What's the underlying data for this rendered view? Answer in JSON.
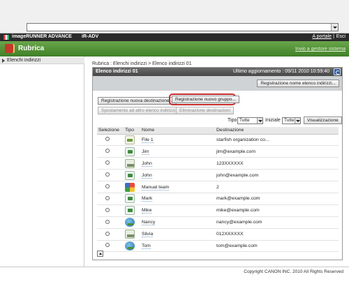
{
  "topbar": {
    "brand": "imageRUNNER ADVANCE",
    "model": "iR-ADV",
    "portal": "A portale",
    "separator": "|",
    "exit": "Esci"
  },
  "header": {
    "title": "Rubrica",
    "goto": "Invio a gestore sistema"
  },
  "sidebar": {
    "items": [
      {
        "label": "Elenchi indirizzi"
      }
    ]
  },
  "breadcrumb": "Rubrica : Elenchi indirizzi > Elenco indirizzi 01",
  "panel": {
    "title": "Elenco indirizzi 01",
    "updated": "Ultimo aggiornamento : 09/11 2010 10:59:40",
    "register_name_button": "Registrazione nome elenco indirizzi...",
    "register_dest_button": "Registrazione nuova destinazione...",
    "register_group_button": "Registrazione nuovo gruppo...",
    "move_button": "Spostamento ad altro elenco indirizzi...",
    "delete_button": "Eliminazione destinazioni"
  },
  "filters": {
    "type_label": "Tipo",
    "type_value": "Tutte",
    "initial_label": "Iniziale",
    "initial_value": "Tutte",
    "show_button": "Visualizzazione"
  },
  "table": {
    "headers": [
      "Selezione",
      "Tipo",
      "Nome",
      "Destinazione"
    ],
    "rows": [
      {
        "type_icon": "file-icon",
        "name": "File 1",
        "destination": "starfish organization co..."
      },
      {
        "type_icon": "email-icon",
        "name": "Jim",
        "destination": "jim@example.com"
      },
      {
        "type_icon": "fax-icon",
        "name": "John",
        "destination": "123XXXXXX"
      },
      {
        "type_icon": "email-icon",
        "name": "John",
        "destination": "john@example.com"
      },
      {
        "type_icon": "group-icon",
        "name": "Manual team",
        "destination": "2"
      },
      {
        "type_icon": "email-icon",
        "name": "Mark",
        "destination": "mark@example.com"
      },
      {
        "type_icon": "email-icon",
        "name": "Mike",
        "destination": "mike@example.com"
      },
      {
        "type_icon": "ifax-icon",
        "name": "Nancy",
        "destination": "nancy@example.com"
      },
      {
        "type_icon": "fax-icon",
        "name": "Silvia",
        "destination": "012XXXXXX"
      },
      {
        "type_icon": "ifax-icon",
        "name": "Tom",
        "destination": "tom@example.com"
      }
    ]
  },
  "footer": {
    "copyright": "Copyright CANON INC. 2010 All Rights Reserved"
  },
  "colors": {
    "header_green": "#4f8f34",
    "highlight_red": "#c52b2b",
    "topbar_dark": "#2b2b2b"
  }
}
